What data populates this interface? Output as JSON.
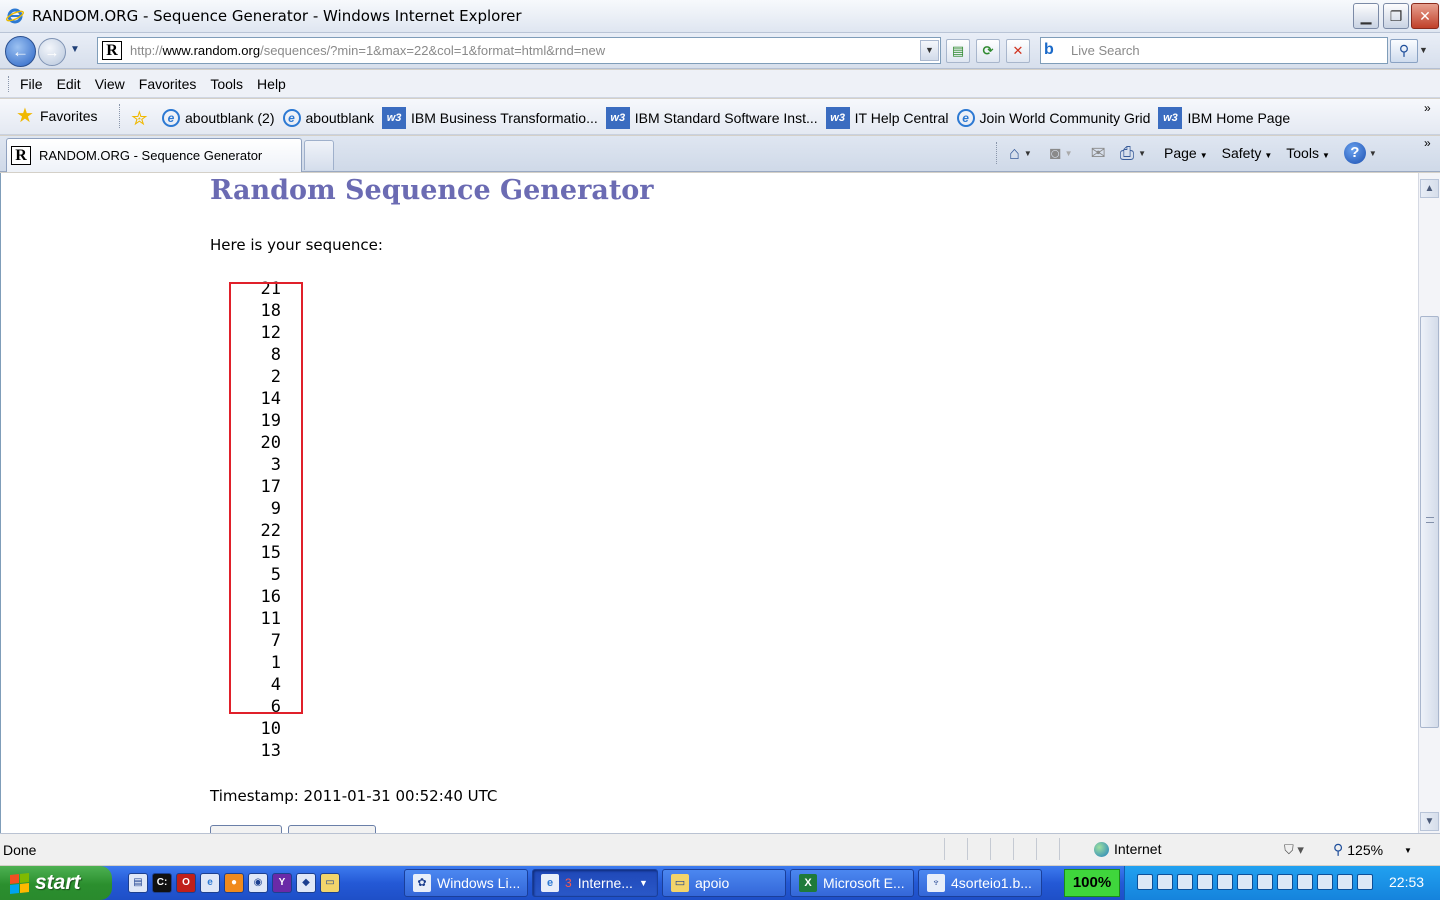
{
  "window": {
    "title": "RANDOM.ORG - Sequence Generator - Windows Internet Explorer",
    "min_symbol": "▁",
    "max_symbol": "❐",
    "close_symbol": "✕"
  },
  "address_bar": {
    "url_prefix": "http://",
    "url_host": "www.random.org",
    "url_rest": "/sequences/?min=1&max=22&col=1&format=html&rnd=new",
    "favicon_letter": "R"
  },
  "search": {
    "placeholder": "Live Search"
  },
  "menu": [
    "File",
    "Edit",
    "View",
    "Favorites",
    "Tools",
    "Help"
  ],
  "favorites_bar": {
    "favorites_label": "Favorites",
    "links": [
      {
        "label": "aboutblank (2)",
        "icon": "ie"
      },
      {
        "label": "aboutblank",
        "icon": "ie"
      },
      {
        "label": "IBM Business Transformatio...",
        "icon": "w3"
      },
      {
        "label": "IBM Standard Software Inst...",
        "icon": "w3"
      },
      {
        "label": "IT Help Central",
        "icon": "w3"
      },
      {
        "label": "Join World Community Grid",
        "icon": "ie"
      },
      {
        "label": "IBM Home Page",
        "icon": "w3"
      }
    ],
    "more": "»"
  },
  "tabs": {
    "active_label": "RANDOM.ORG - Sequence Generator",
    "more": "»"
  },
  "command_bar": {
    "page": "Page",
    "safety": "Safety",
    "tools": "Tools",
    "help": "?"
  },
  "page": {
    "heading": "Random Sequence Generator",
    "intro": "Here is your sequence:",
    "sequence": [
      "21",
      "18",
      "12",
      "8",
      "2",
      "14",
      "19",
      "20",
      "3",
      "17",
      "9",
      "22",
      "15",
      "5",
      "16",
      "11",
      "7",
      "1",
      "4",
      "6",
      "10",
      "13"
    ],
    "timestamp": "Timestamp: 2011-01-31 00:52:40 UTC"
  },
  "status_bar": {
    "status": "Done",
    "zone": "Internet",
    "zoom": "125%"
  },
  "taskbar": {
    "start": "start",
    "buttons": [
      {
        "label": "Windows Li..."
      },
      {
        "label": "Interne...",
        "badge": "3"
      },
      {
        "label": "apoio"
      },
      {
        "label": "Microsoft E..."
      },
      {
        "label": "4sorteio1.b..."
      }
    ],
    "battery": "100%",
    "clock": "22:53"
  },
  "colors": {
    "heading": "#6b6bb3",
    "highlight_box": "#e0202a",
    "start_button": "#2b8f2e"
  }
}
